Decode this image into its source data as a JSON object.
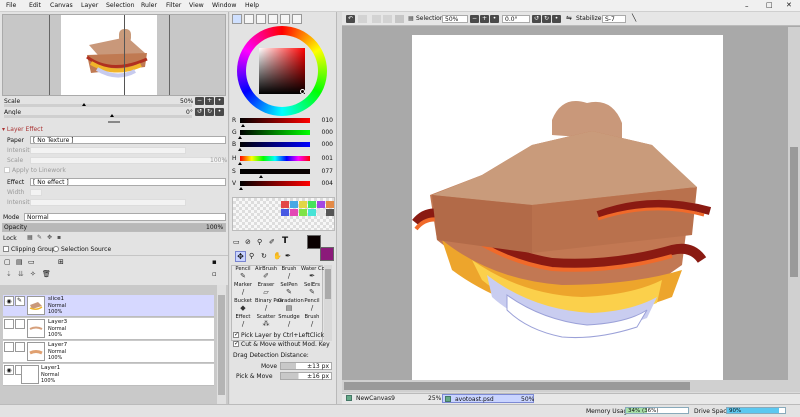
{
  "menu": [
    "File",
    "Edit",
    "Canvas",
    "Layer",
    "Selection",
    "Ruler",
    "Filter",
    "View",
    "Window",
    "Help"
  ],
  "navigator": {
    "scale_label": "Scale",
    "scale_value": "50%",
    "angle_label": "Angle",
    "angle_value": "0°"
  },
  "layer_effect": {
    "header": "Layer Effect",
    "paper_label": "Paper",
    "paper_value": "[ No Texture ]",
    "intensity_label": "Intensity",
    "scale_label": "Scale",
    "scale_value": "100%",
    "apply_label": "Apply to Linework",
    "effect_label": "Effect",
    "effect_value": "[ No effect ]",
    "width_label": "Width",
    "intensity2_label": "Intensity"
  },
  "layer_props": {
    "mode_label": "Mode",
    "mode_value": "Normal",
    "opacity_label": "Opacity",
    "opacity_value": "100%",
    "opacity_fraction": 1.0,
    "lock_label": "Lock",
    "clipping_label": "Clipping Group",
    "selsource_label": "Selection Source"
  },
  "layers": [
    {
      "name": "slice1",
      "mode": "Normal",
      "opacity": "100%",
      "selected": true,
      "visible": true
    },
    {
      "name": "Layer3",
      "mode": "Normal",
      "opacity": "100%",
      "selected": false,
      "visible": false
    },
    {
      "name": "Layer7",
      "mode": "Normal",
      "opacity": "100%",
      "selected": false,
      "visible": false
    },
    {
      "name": "Layer1",
      "mode": "Normal",
      "opacity": "100%",
      "selected": false,
      "visible": true
    }
  ],
  "color": {
    "sliders": [
      {
        "label": "R",
        "value": "010",
        "fraction": 0.04
      },
      {
        "label": "G",
        "value": "000",
        "fraction": 0.0
      },
      {
        "label": "B",
        "value": "000",
        "fraction": 0.0
      },
      {
        "label": "H",
        "value": "001",
        "fraction": 0.0
      },
      {
        "label": "S",
        "value": "077",
        "fraction": 0.3
      },
      {
        "label": "V",
        "value": "004",
        "fraction": 0.02
      }
    ],
    "main_color": "#0a0000",
    "sub_color": "#8b1a7a",
    "swatches": [
      "#e34747",
      "#47a8e3",
      "#e3d647",
      "#47e35a",
      "#a447e3",
      "#e38a47",
      "#4759e3",
      "#e347b4",
      "#7fe347",
      "#47e3d6",
      "#e3e3e3",
      "#555555"
    ]
  },
  "tools": [
    {
      "label": "Pencil",
      "icon": "pencil-icon",
      "glyph": "✎"
    },
    {
      "label": "AirBrush",
      "icon": "airbrush-icon",
      "glyph": "✐"
    },
    {
      "label": "Brush",
      "icon": "brush-icon",
      "glyph": "/"
    },
    {
      "label": "Water Color",
      "icon": "watercolor-icon",
      "glyph": "✒"
    },
    {
      "label": "Marker",
      "icon": "marker-icon",
      "glyph": "/"
    },
    {
      "label": "Eraser",
      "icon": "eraser-icon",
      "glyph": "▱"
    },
    {
      "label": "SelPen",
      "icon": "selpen-icon",
      "glyph": "✎"
    },
    {
      "label": "SelErs",
      "icon": "selers-icon",
      "glyph": "✎"
    },
    {
      "label": "Bucket",
      "icon": "bucket-icon",
      "glyph": "◆"
    },
    {
      "label": "Binary Pen",
      "icon": "binarypen-icon",
      "glyph": "/"
    },
    {
      "label": "Gradation",
      "icon": "gradation-icon",
      "glyph": "▤"
    },
    {
      "label": "Pencil",
      "icon": "pencil2-icon",
      "glyph": "/"
    },
    {
      "label": "Effect",
      "icon": "effect-icon",
      "glyph": "/"
    },
    {
      "label": "Scatter",
      "icon": "scatter-icon",
      "glyph": "⁂"
    },
    {
      "label": "Smudge",
      "icon": "smudge-icon",
      "glyph": "/"
    },
    {
      "label": "Brush",
      "icon": "brush2-icon",
      "glyph": "/"
    }
  ],
  "options": {
    "pick_layer_label": "Pick Layer by Ctrl+LeftClick",
    "cut_move_label": "Cut & Move without Mod. Key",
    "drag_title": "Drag Detection Distance:",
    "move_label": "Move",
    "move_value": "±13 px",
    "pickmove_label": "Pick & Move",
    "pickmove_value": "±16 px"
  },
  "canvas_toolbar": {
    "selection_label": "Selection",
    "zoom_value": "50%",
    "angle_value": "0.0°",
    "stabilizer_label": "Stabilizer",
    "stabilizer_value": "S-7"
  },
  "tabs": [
    {
      "name": "NewCanvas9",
      "zoom": "25%"
    },
    {
      "name": "avotoast.psd",
      "zoom": "50%"
    }
  ],
  "status": {
    "memory_label": "Memory Usage",
    "memory_value": "34% (36%)",
    "memory_fraction": 0.34,
    "drive_label": "Drive Space",
    "drive_value": "90%",
    "drive_fraction": 0.9
  }
}
